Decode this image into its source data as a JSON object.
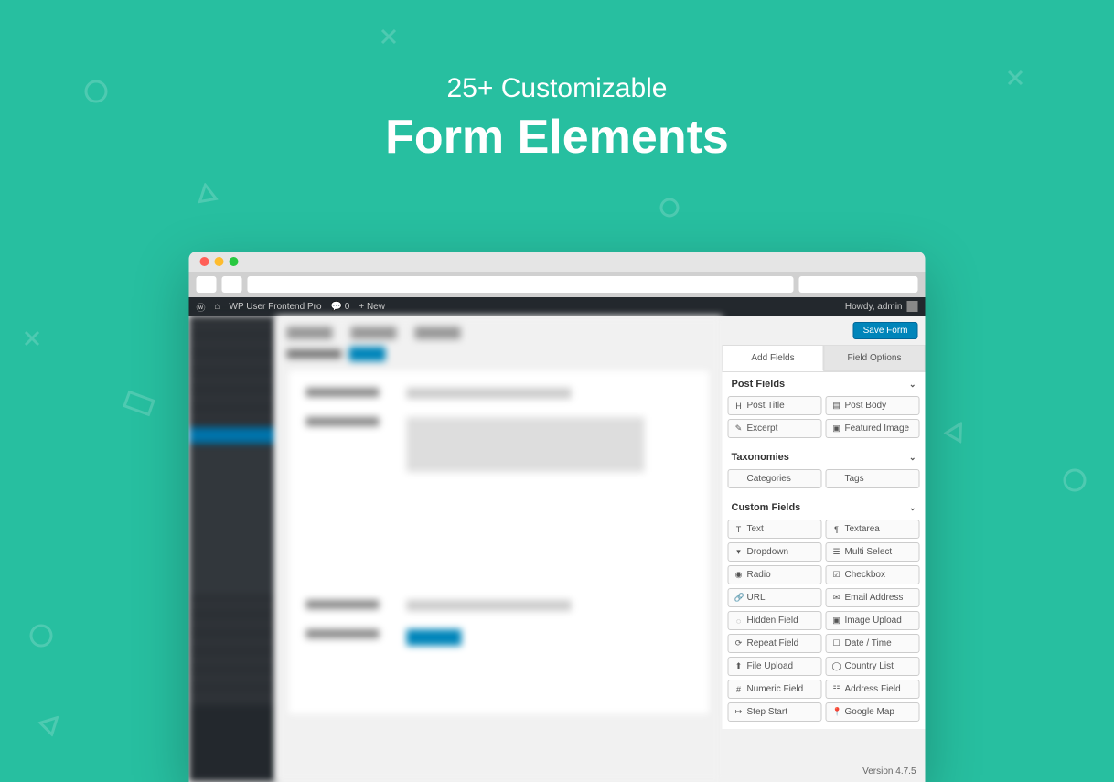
{
  "hero": {
    "subtitle": "25+ Customizable",
    "title": "Form Elements"
  },
  "wpbar": {
    "site": "WP User Frontend Pro",
    "comments": "0",
    "new": "New",
    "howdy": "Howdy, admin"
  },
  "actions": {
    "save": "Save Form"
  },
  "panel_tabs": {
    "add_fields": "Add Fields",
    "field_options": "Field Options"
  },
  "sections": {
    "post_fields": {
      "title": "Post Fields",
      "items": [
        {
          "icon": "H",
          "label": "Post Title"
        },
        {
          "icon": "▤",
          "label": "Post Body"
        },
        {
          "icon": "✎",
          "label": "Excerpt"
        },
        {
          "icon": "▣",
          "label": "Featured Image"
        }
      ]
    },
    "taxonomies": {
      "title": "Taxonomies",
      "items": [
        {
          "icon": "",
          "label": "Categories"
        },
        {
          "icon": "",
          "label": "Tags"
        }
      ]
    },
    "custom_fields": {
      "title": "Custom Fields",
      "items": [
        {
          "icon": "T",
          "label": "Text"
        },
        {
          "icon": "¶",
          "label": "Textarea"
        },
        {
          "icon": "▾",
          "label": "Dropdown"
        },
        {
          "icon": "☰",
          "label": "Multi Select"
        },
        {
          "icon": "◉",
          "label": "Radio"
        },
        {
          "icon": "☑",
          "label": "Checkbox"
        },
        {
          "icon": "🔗",
          "label": "URL"
        },
        {
          "icon": "✉",
          "label": "Email Address"
        },
        {
          "icon": "◌",
          "label": "Hidden Field"
        },
        {
          "icon": "▣",
          "label": "Image Upload"
        },
        {
          "icon": "⟳",
          "label": "Repeat Field"
        },
        {
          "icon": "☐",
          "label": "Date / Time"
        },
        {
          "icon": "⬆",
          "label": "File Upload"
        },
        {
          "icon": "◯",
          "label": "Country List"
        },
        {
          "icon": "#",
          "label": "Numeric Field"
        },
        {
          "icon": "☷",
          "label": "Address Field"
        },
        {
          "icon": "↦",
          "label": "Step Start"
        },
        {
          "icon": "📍",
          "label": "Google Map"
        }
      ]
    }
  },
  "version": "Version 4.7.5"
}
